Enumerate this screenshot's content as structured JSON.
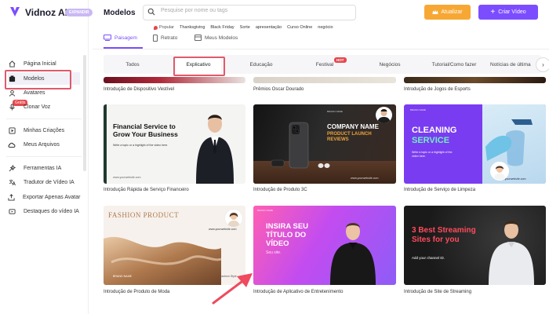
{
  "brand": {
    "name": "Vidnoz AI",
    "badge": "EXPANDIR"
  },
  "sidebar": {
    "items": [
      {
        "label": "Página Inicial",
        "icon": "home-icon"
      },
      {
        "label": "Modelos",
        "icon": "templates-icon"
      },
      {
        "label": "Avatares",
        "icon": "avatar-icon"
      },
      {
        "label": "Clonar Voz",
        "icon": "voice-clone-icon",
        "tag": "Grátis"
      },
      {
        "label": "Minhas Criações",
        "icon": "my-creations-icon"
      },
      {
        "label": "Meus Arquivos",
        "icon": "cloud-files-icon"
      },
      {
        "label": "Ferramentas IA",
        "icon": "ai-tools-icon"
      },
      {
        "label": "Tradutor de Vídeo IA",
        "icon": "translate-icon"
      },
      {
        "label": "Exportar Apenas Avatar",
        "icon": "export-avatar-icon"
      },
      {
        "label": "Destaques do vídeo IA",
        "icon": "highlights-icon"
      }
    ]
  },
  "header": {
    "title": "Modelos",
    "search_placeholder": "Pesquise por nome ou tags",
    "popular_label": "Popular",
    "tags": [
      "Thanksgiving",
      "Black Friday",
      "Sorte",
      "apresentação",
      "Curso Online",
      "negócio"
    ],
    "upgrade_label": "Atualizar",
    "create_label": "Criar Vídeo"
  },
  "orientation_tabs": [
    "Paisagem",
    "Retrato",
    "Meus Modelos"
  ],
  "categories": {
    "items": [
      "Todos",
      "Explicativo",
      "Educação",
      "Festival",
      "Negócios",
      "Tutorial/Como fazer",
      "Notícias de última"
    ],
    "active": "Explicativo",
    "hot_badge": "HOT"
  },
  "top_row_captions": [
    "Introdução de Dispositivo Vestível",
    "Prêmios Oscar Dourado",
    "Introdução de Jogos de Esports"
  ],
  "templates": [
    {
      "caption": "Introdução Rápida de Serviço Financeiro",
      "title": "Financial Service to Grow Your Business",
      "sub": "Write a topic or a highlight of the video here.",
      "footer": "www.yourwebsite.com"
    },
    {
      "caption": "Introdução de Produto 3C",
      "brand": "BRAND NAME",
      "title": "COMPANY NAME",
      "highlight": "PRODUCT LAUNCH REVIEWS",
      "footer": "www.yourwebsite.com"
    },
    {
      "caption": "Introdução de Serviço de Limpeza",
      "brand": "BRAND NAME",
      "title": "CLEANING",
      "highlight": "SERVICE",
      "sub": "Write a topic or a highlight of the video here.",
      "footer": "www.yourwebsite.com"
    },
    {
      "caption": "Introdução de Produto de Moda",
      "title": "FASHION PRODUCT",
      "url": "www.yourwebsite.com",
      "footer_left": "BRAND NAME",
      "footer_right": "Fashion Style"
    },
    {
      "caption": "Introdução de Aplicativo de Entretenimento",
      "title": "INSIRA SEU TÍTULO DO VÍDEO",
      "sub": "Seu site.",
      "brand": "BRAND NAME"
    },
    {
      "caption": "Introdução de Site de Streaming",
      "title": "3 Best Streaming Sites for you",
      "sub": "Add your channel ID."
    }
  ],
  "colors": {
    "accent": "#7c4dff",
    "upgrade": "#f7a834",
    "highlight_box": "#e05a6a",
    "arrow": "#ef4a5e"
  }
}
